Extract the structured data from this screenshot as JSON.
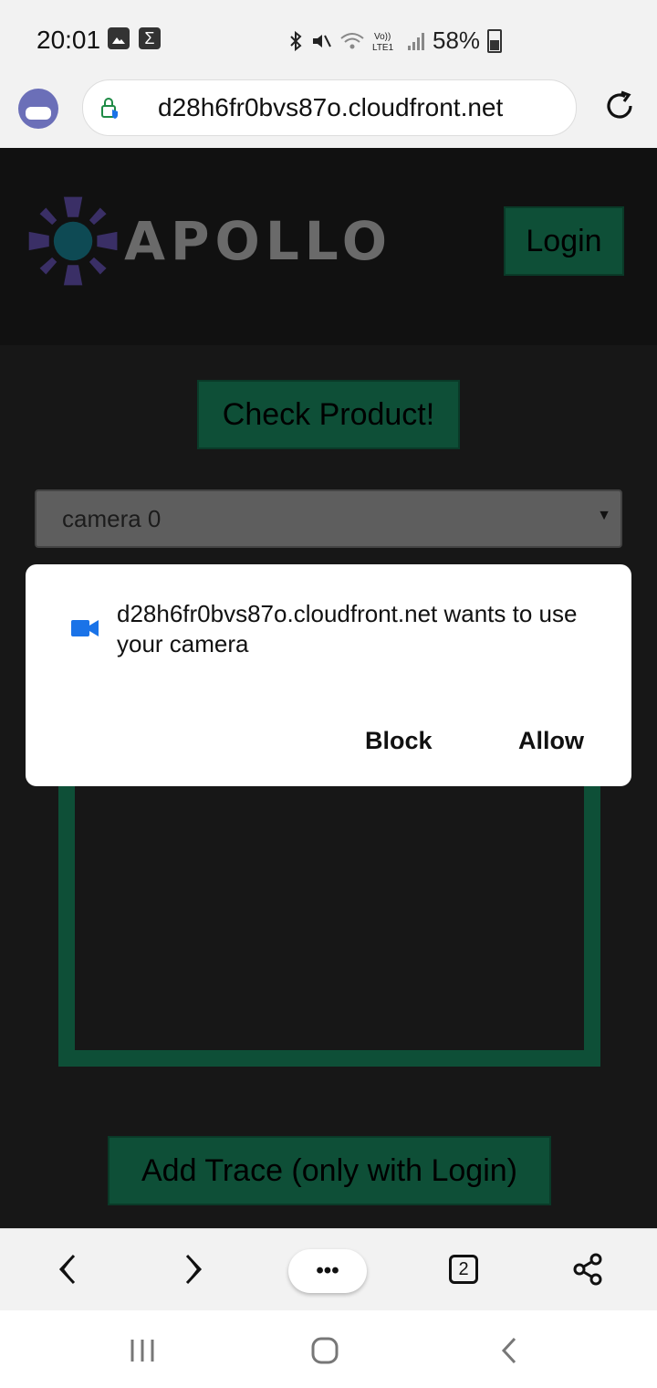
{
  "status_bar": {
    "time": "20:01",
    "battery": "58%",
    "icons": [
      "gallery-icon",
      "sigma-icon",
      "bluetooth-icon",
      "mute-icon",
      "wifi-icon",
      "volte-icon",
      "signal-icon",
      "battery-icon"
    ]
  },
  "browser": {
    "url": "d28h6fr0bvs87o.cloudfront.net",
    "tabs_count": "2",
    "menu_label": "•••"
  },
  "page": {
    "logo_text": "APOLLO",
    "login_label": "Login",
    "check_label": "Check Product!",
    "camera_select_value": "camera 0",
    "add_trace_label": "Add Trace (only with Login)"
  },
  "dialog": {
    "message": "d28h6fr0bvs87o.cloudfront.net wants to use your camera",
    "block_label": "Block",
    "allow_label": "Allow"
  },
  "colors": {
    "accent_green": "#0e4f37",
    "dialog_icon_blue": "#1a73e8"
  }
}
